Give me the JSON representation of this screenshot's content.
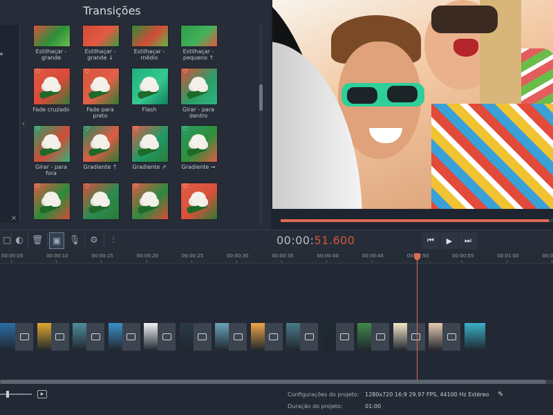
{
  "panel": {
    "title": "Transições",
    "close": "×",
    "collapse": "‹",
    "tiles": [
      {
        "label": "Estilhaçar - grande",
        "heart": false,
        "c1": "#d5523d",
        "c2": "#2d8f3a",
        "c3": "#6cc04a"
      },
      {
        "label": "Estilhaçar - grande ↓",
        "heart": false,
        "c1": "#d24a36",
        "c2": "#e35a44",
        "c3": "#3a9a3e"
      },
      {
        "label": "Estilhaçar - médio",
        "heart": false,
        "c1": "#2c8b3a",
        "c2": "#d34b37",
        "c3": "#5fb646"
      },
      {
        "label": "Estilhaçar - pequeno ↑",
        "heart": false,
        "c1": "#2e9b48",
        "c2": "#43b25a",
        "c3": "#e25741"
      },
      {
        "label": "Fade cruzado",
        "heart": true,
        "c1": "#e05a43",
        "c2": "#d9493a",
        "c3": "#2e7d35"
      },
      {
        "label": "Fade para preto",
        "heart": true,
        "c1": "#d95540",
        "c2": "#e06048",
        "c3": "#2c7a33"
      },
      {
        "label": "Flash",
        "heart": false,
        "c1": "#1fae7c",
        "c2": "#35c990",
        "c3": "#0f7f5b"
      },
      {
        "label": "Girar - para dentro",
        "heart": true,
        "c1": "#d94f3b",
        "c2": "#2f9c67",
        "c3": "#2bb57f"
      },
      {
        "label": "Girar - para fora",
        "heart": true,
        "c1": "#2b9e6a",
        "c2": "#d04c38",
        "c3": "#34b07b"
      },
      {
        "label": "Gradiente ↑",
        "heart": true,
        "c1": "#1e8d5e",
        "c2": "#e05b44",
        "c3": "#2a7a36"
      },
      {
        "label": "Gradiente ↗",
        "heart": true,
        "c1": "#e15c45",
        "c2": "#1f9a68",
        "c3": "#2c7c36"
      },
      {
        "label": "Gradiente →",
        "heart": true,
        "c1": "#2a9a66",
        "c2": "#2f8f3a",
        "c3": "#e05a44"
      },
      {
        "label": "",
        "heart": true,
        "c1": "#e05a44",
        "c2": "#2a8a3a",
        "c3": "#d44c38"
      },
      {
        "label": "",
        "heart": true,
        "c1": "#d94e3a",
        "c2": "#2c8a52",
        "c3": "#2a7b35"
      },
      {
        "label": "",
        "heart": true,
        "c1": "#e05a43",
        "c2": "#2b8940",
        "c3": "#d84c38"
      },
      {
        "label": "",
        "heart": true,
        "c1": "#e25d45",
        "c2": "#d8503b",
        "c3": "#2c7b36"
      }
    ]
  },
  "player": {
    "time_prefix": "00:00:",
    "time_value": "51.600",
    "progress": 0.985,
    "buttons": {
      "prev": "⏮",
      "play": "▶",
      "next": "⏭"
    }
  },
  "toolbar": {
    "icons": [
      "crop-icon",
      "color-adjust-icon",
      "trash-icon",
      "image-icon",
      "microphone-icon",
      "gear-icon",
      "equalizer-icon"
    ],
    "glyphs": [
      "▢",
      "◐",
      "🗑",
      "▣",
      "🎙",
      "⚙",
      "⫶"
    ]
  },
  "timeline": {
    "ticks": [
      "00:00:05",
      "00:00:10",
      "00:00:15",
      "00:00:20",
      "00:00:25",
      "00:00:30",
      "00:00:35",
      "00:00:40",
      "00:00:45",
      "00:00:50",
      "00:00:55",
      "00:01:00",
      "00:01:05"
    ],
    "clip_colors": [
      "#2a6ea8",
      "#e2a92d",
      "#4f8e9c",
      "#3a8fc8",
      "#f2f4f6",
      "#2a3a4a",
      "#6aa3b8",
      "#f0a64a",
      "#4a7a8a",
      "#1f2a30",
      "#3f8a4a",
      "#f3e7c8",
      "#e8c9b0",
      "#3ab0c8"
    ]
  },
  "status": {
    "config_label": "Configurações do projeto:",
    "config_value": "1280x720 16:9 29.97 FPS, 44100 Hz Estéreo",
    "duration_label": "Duração do projeto:",
    "duration_value": "01:00",
    "edit_glyph": "✎"
  }
}
